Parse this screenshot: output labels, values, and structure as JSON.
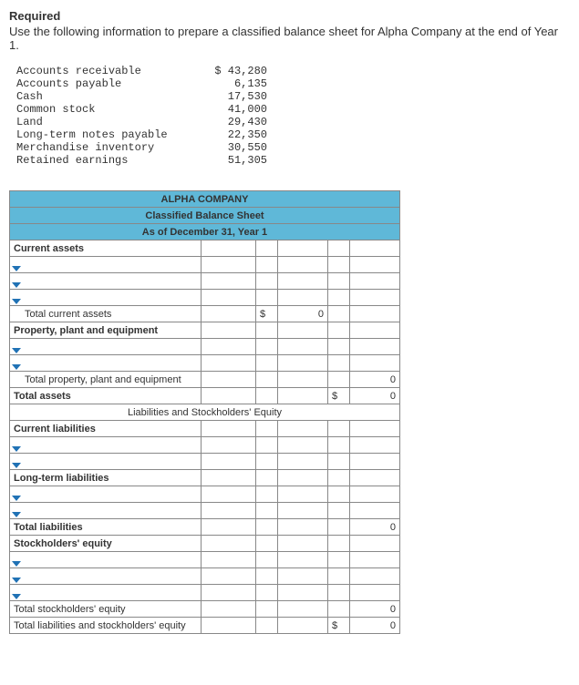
{
  "required_label": "Required",
  "instructions": "Use the following information to prepare a classified balance sheet for Alpha Company at the end of Year 1.",
  "accounts": [
    {
      "label": "Accounts receivable",
      "value": "$ 43,280"
    },
    {
      "label": "Accounts payable",
      "value": "6,135"
    },
    {
      "label": "Cash",
      "value": "17,530"
    },
    {
      "label": "Common stock",
      "value": "41,000"
    },
    {
      "label": "Land",
      "value": "29,430"
    },
    {
      "label": "Long-term notes payable",
      "value": "22,350"
    },
    {
      "label": "Merchandise inventory",
      "value": "30,550"
    },
    {
      "label": "Retained earnings",
      "value": "51,305"
    }
  ],
  "bs": {
    "h1": "ALPHA COMPANY",
    "h2": "Classified Balance Sheet",
    "h3": "As of December 31, Year 1",
    "sec_current_assets": "Current assets",
    "tot_current_assets": "Total current assets",
    "sec_ppe": "Property, plant and equipment",
    "tot_ppe": "Total property, plant and equipment",
    "tot_assets": "Total assets",
    "liab_se_hdr": "Liabilities and Stockholders' Equity",
    "sec_cl": "Current liabilities",
    "sec_ltl": "Long-term liabilities",
    "tot_liab": "Total liabilities",
    "sec_se": "Stockholders' equity",
    "tot_se": "Total stockholders' equity",
    "tot_all": "Total liabilities and stockholders' equity",
    "cur": "$",
    "zero": "0"
  }
}
